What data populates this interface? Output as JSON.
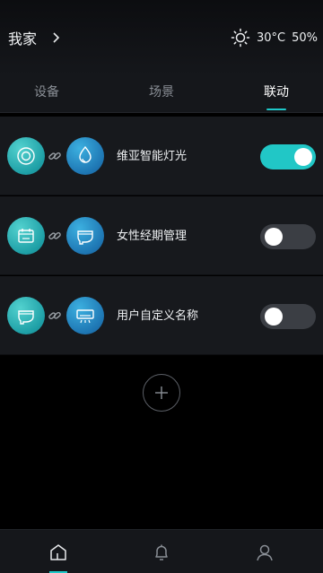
{
  "header": {
    "home_name": "我家",
    "temperature": "30°C",
    "humidity": "50%"
  },
  "tabs": [
    {
      "label": "设备",
      "active": false
    },
    {
      "label": "场景",
      "active": false
    },
    {
      "label": "联动",
      "active": true
    }
  ],
  "linkages": [
    {
      "name": "维亚智能灯光",
      "trigger_icon": "target-sensor-icon",
      "action_icon": "light-bulb-icon",
      "enabled": true
    },
    {
      "name": "女性经期管理",
      "trigger_icon": "calendar-icon",
      "action_icon": "toilet-seat-icon",
      "enabled": false
    },
    {
      "name": "用户自定义名称",
      "trigger_icon": "toilet-seat-icon",
      "action_icon": "air-conditioner-icon",
      "enabled": false
    }
  ],
  "bottom_nav": [
    {
      "icon": "home-icon",
      "active": true
    },
    {
      "icon": "bell-icon",
      "active": false
    },
    {
      "icon": "user-icon",
      "active": false
    }
  ],
  "colors": {
    "accent": "#1ec8c9",
    "row_bg": "#17191d",
    "toggle_off": "#3b3e44"
  }
}
